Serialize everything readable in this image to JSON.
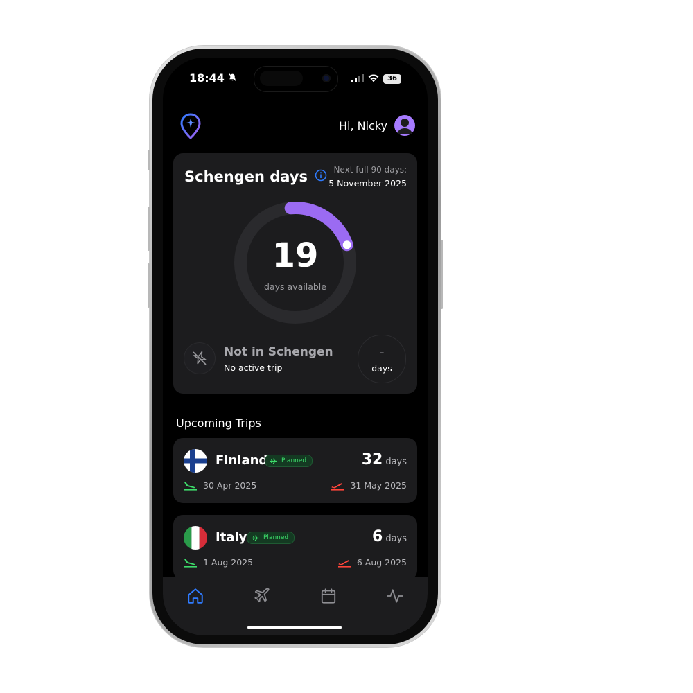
{
  "status_bar": {
    "time": "18:44",
    "battery": "36"
  },
  "header": {
    "greeting": "Hi, Nicky"
  },
  "schengen": {
    "title": "Schengen days",
    "next_label": "Next full 90 days:",
    "next_date": "5 November 2025",
    "days_available": "19",
    "days_available_label": "days available",
    "progress_fraction": 0.21,
    "status_title": "Not in Schengen",
    "status_subtitle": "No active trip",
    "status_days_value": "-",
    "status_days_label": "days"
  },
  "section": {
    "upcoming_title": "Upcoming Trips"
  },
  "trips": [
    {
      "country": "Finland",
      "badge": "Planned",
      "days": "32",
      "days_unit": "days",
      "depart": "30 Apr 2025",
      "arrive": "31 May 2025"
    },
    {
      "country": "Italy",
      "badge": "Planned",
      "days": "6",
      "days_unit": "days",
      "depart": "1 Aug 2025",
      "arrive": "6 Aug 2025"
    }
  ],
  "tabs": {
    "icons": [
      "home-icon",
      "airplane-icon",
      "calendar-icon",
      "activity-icon"
    ],
    "active": "home-icon"
  },
  "colors": {
    "accent_purple": "#9b6bf2",
    "accent_blue": "#2f7bff",
    "planned_green": "#3ddc6a",
    "arrival_red": "#ff453a",
    "card_bg": "#1c1c1e"
  }
}
